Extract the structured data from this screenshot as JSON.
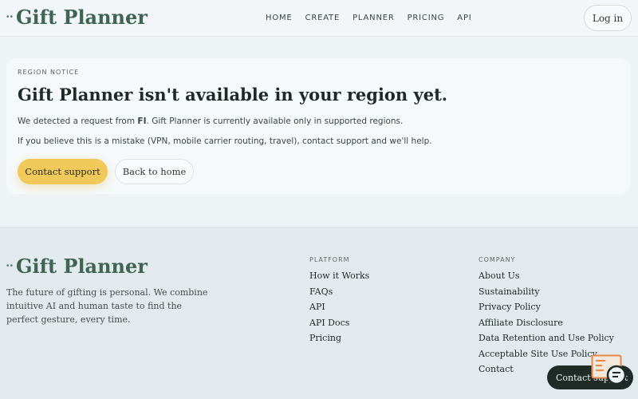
{
  "brand": {
    "logo_dots": "••",
    "name": "Gift Planner"
  },
  "nav": {
    "items": [
      "HOME",
      "CREATE",
      "PLANNER",
      "PRICING",
      "API"
    ]
  },
  "header": {
    "login_label": "Log in"
  },
  "notice": {
    "kicker": "REGION NOTICE",
    "title": "Gift Planner isn't available in your region yet.",
    "line1_prefix": "We detected a request from ",
    "line1_region": "FI",
    "line1_suffix": ". Gift Planner is currently available only in supported regions.",
    "line2": "If you believe this is a mistake (VPN, mobile carrier routing, travel), contact support and we'll help.",
    "primary_button": "Contact support",
    "secondary_button": "Back to home"
  },
  "footer": {
    "description": "The future of gifting is personal. We combine intuitive AI and human taste to find the perfect gesture, every time.",
    "platform": {
      "heading": "PLATFORM",
      "links": [
        "How it Works",
        "FAQs",
        "API",
        "API Docs",
        "Pricing"
      ]
    },
    "company": {
      "heading": "COMPANY",
      "links": [
        "About Us",
        "Sustainability",
        "Privacy Policy",
        "Affiliate Disclosure",
        "Data Retention and Use Policy",
        "Acceptable Site Use Policy",
        "Contact"
      ]
    }
  },
  "floating": {
    "contact_label": "Contact support",
    "chat_icon": "chat-support-icon"
  },
  "colors": {
    "brand_green": "#3f6452",
    "accent_yellow": "#f1c85a",
    "dark": "#1f2b27",
    "icon_orange": "#e8894a"
  }
}
